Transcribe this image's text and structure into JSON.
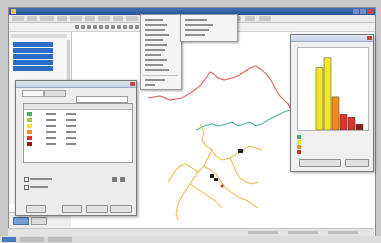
{
  "colors": {
    "titlebar": "#2a5597",
    "selection": "#2d6cc4",
    "network_red": "#e0605f",
    "network_green": "#4fb8a0",
    "network_yellow": "#e8b84a",
    "histogram_yellow": "#f2e52c",
    "histogram_orange": "#f08c1a",
    "histogram_red": "#d8342a",
    "histogram_darkred": "#8f1d14"
  },
  "icons": [
    "app-icon",
    "minimize-icon",
    "maximize-icon",
    "close-icon",
    "open-icon",
    "save-icon",
    "zoom-icon",
    "pan-icon",
    "select-icon"
  ],
  "chart_data": {
    "type": "bar",
    "categories": [
      "1",
      "2",
      "3",
      "4",
      "5",
      "6"
    ],
    "values": [
      64,
      74,
      34,
      16,
      13,
      6
    ],
    "legend_entries": [
      "",
      "",
      "",
      ""
    ]
  }
}
